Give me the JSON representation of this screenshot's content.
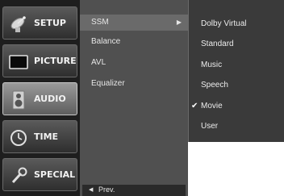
{
  "categories": [
    {
      "label": "SETUP",
      "icon": "satellite-dish-icon"
    },
    {
      "label": "PICTURE",
      "icon": "monitor-icon"
    },
    {
      "label": "AUDIO",
      "icon": "speaker-icon"
    },
    {
      "label": "TIME",
      "icon": "clock-icon"
    },
    {
      "label": "SPECIAL",
      "icon": "wrench-icon"
    }
  ],
  "selected_category": "AUDIO",
  "submenu": {
    "items": [
      {
        "label": "SSM",
        "has_submenu": true
      },
      {
        "label": "Balance"
      },
      {
        "label": "AVL"
      },
      {
        "label": "Equalizer"
      }
    ],
    "active_item": "SSM",
    "submenu_arrow": "▶",
    "prev_arrow": "◀",
    "prev_label": "Prev."
  },
  "options": {
    "items": [
      "Dolby Virtual",
      "Standard",
      "Music",
      "Speech",
      "Movie",
      "User"
    ],
    "selected": "Movie",
    "check_mark": "✔"
  },
  "colors": {
    "sidebar_bg": "#1e1e1e",
    "submenu_bg": "#505050",
    "options_bg": "#3a3a3a",
    "selected_category_bg": "#7a7a7a"
  }
}
